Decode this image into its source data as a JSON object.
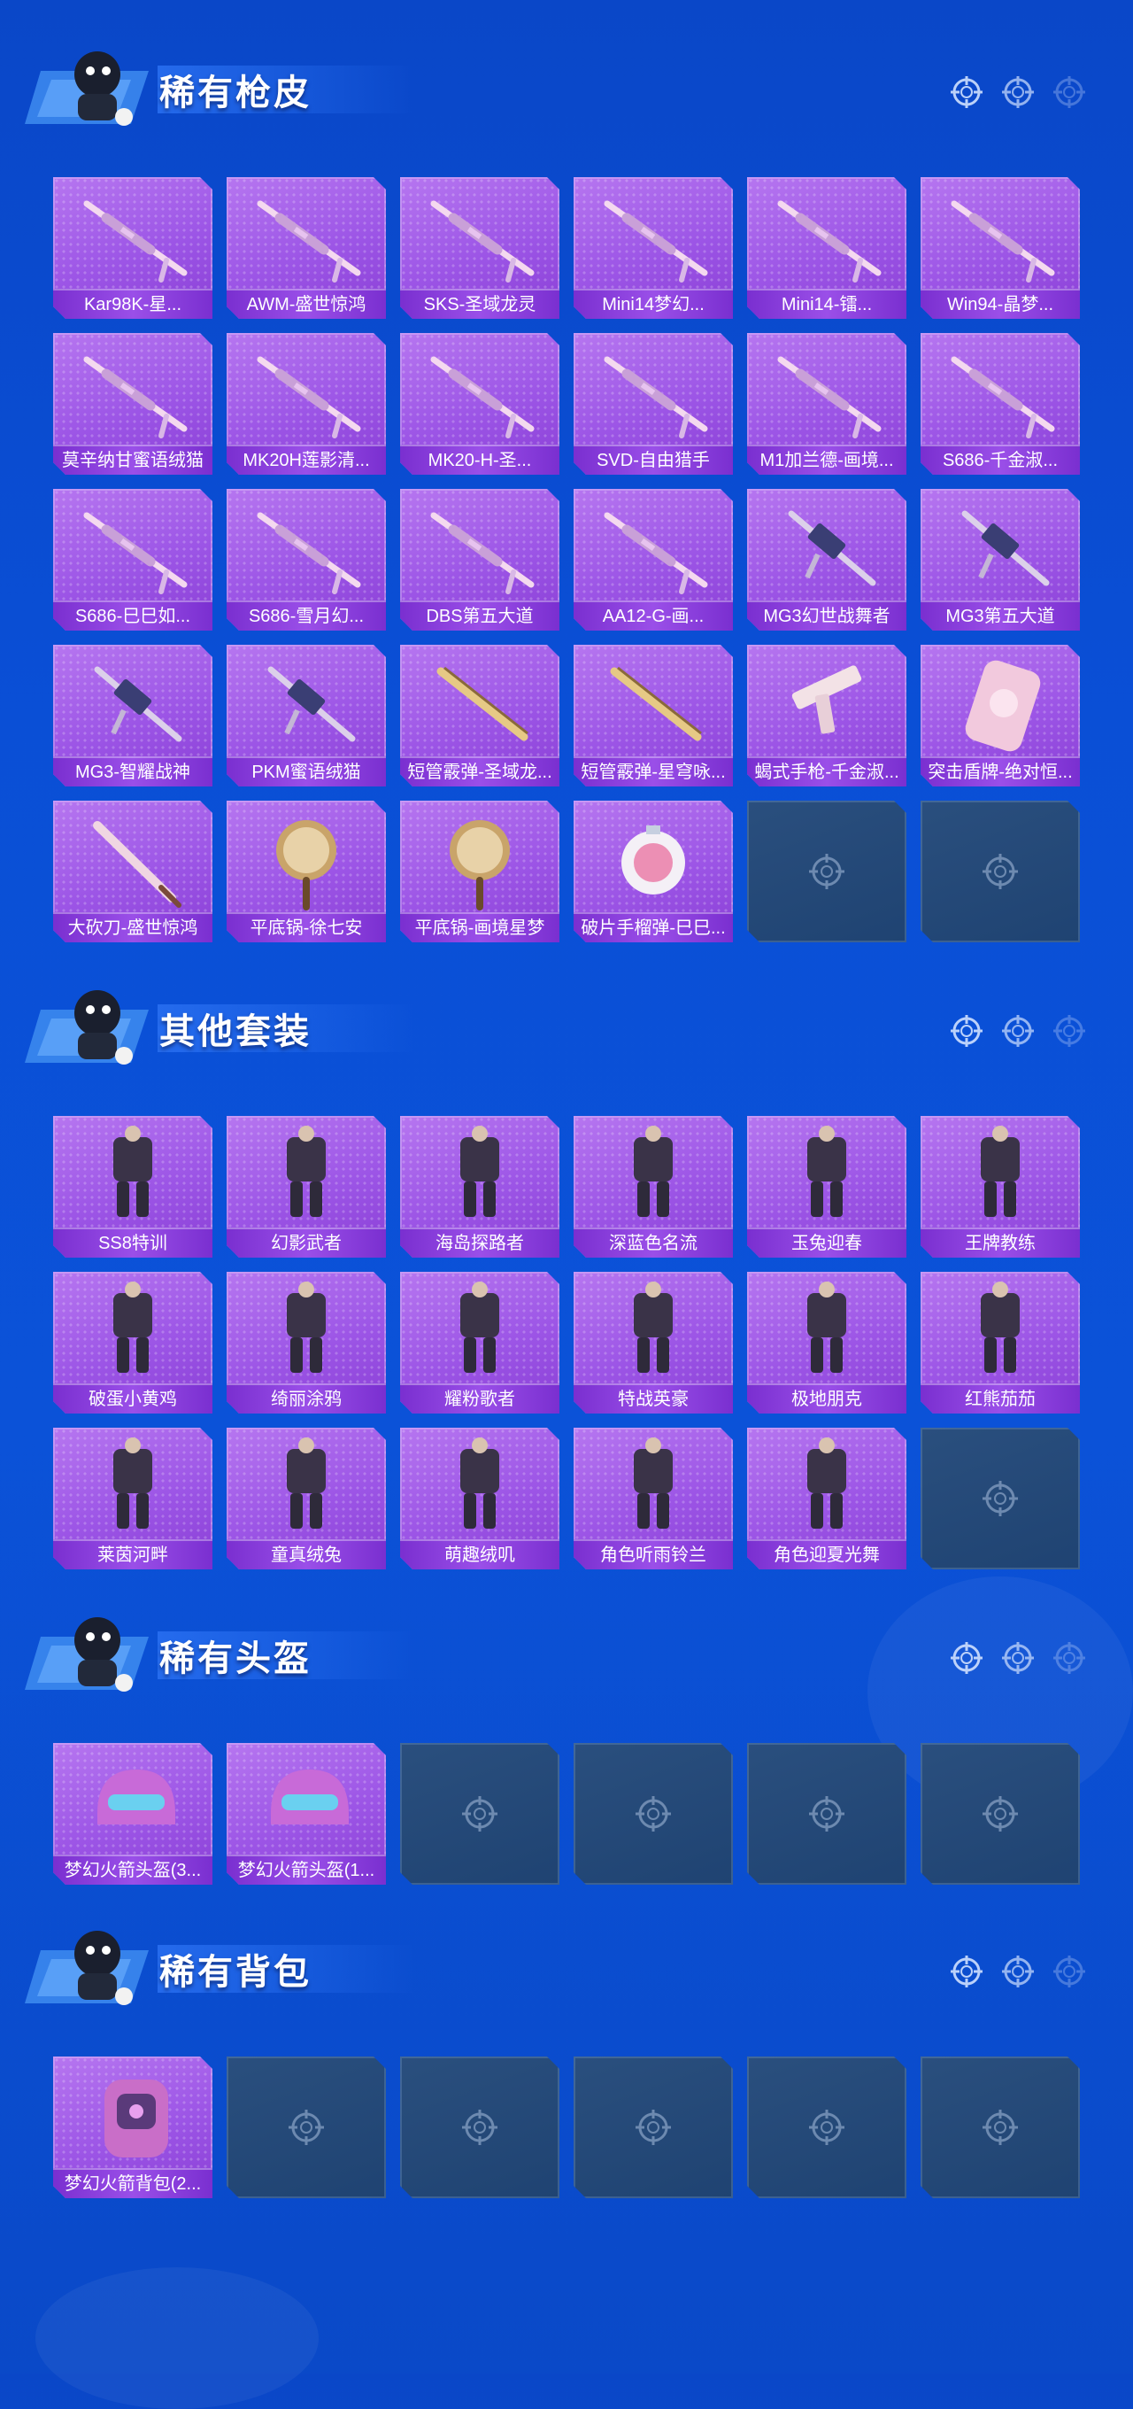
{
  "sections": [
    {
      "title": "稀有枪皮",
      "items": [
        {
          "label": "Kar98K-星...",
          "icon": "rifle"
        },
        {
          "label": "AWM-盛世惊鸿",
          "icon": "rifle"
        },
        {
          "label": "SKS-圣域龙灵",
          "icon": "rifle"
        },
        {
          "label": "Mini14梦幻...",
          "icon": "rifle"
        },
        {
          "label": "Mini14-镭...",
          "icon": "rifle"
        },
        {
          "label": "Win94-晶梦...",
          "icon": "rifle"
        },
        {
          "label": "莫辛纳甘蜜语绒猫",
          "icon": "rifle"
        },
        {
          "label": "MK20H莲影清...",
          "icon": "rifle"
        },
        {
          "label": "MK20-H-圣...",
          "icon": "rifle"
        },
        {
          "label": "SVD-自由猎手",
          "icon": "rifle"
        },
        {
          "label": "M1加兰德-画境...",
          "icon": "rifle"
        },
        {
          "label": "S686-千金淑...",
          "icon": "rifle"
        },
        {
          "label": "S686-巳巳如...",
          "icon": "rifle"
        },
        {
          "label": "S686-雪月幻...",
          "icon": "rifle"
        },
        {
          "label": "DBS第五大道",
          "icon": "rifle"
        },
        {
          "label": "AA12-G-画...",
          "icon": "rifle"
        },
        {
          "label": "MG3幻世战舞者",
          "icon": "machinegun"
        },
        {
          "label": "MG3第五大道",
          "icon": "machinegun"
        },
        {
          "label": "MG3-智耀战神",
          "icon": "machinegun"
        },
        {
          "label": "PKM蜜语绒猫",
          "icon": "machinegun"
        },
        {
          "label": "短管霰弹-圣域龙...",
          "icon": "shotgun"
        },
        {
          "label": "短管霰弹-星穹咏...",
          "icon": "shotgun"
        },
        {
          "label": "蝎式手枪-千金淑...",
          "icon": "pistol"
        },
        {
          "label": "突击盾牌-绝对恒...",
          "icon": "shield"
        },
        {
          "label": "大砍刀-盛世惊鸿",
          "icon": "machete"
        },
        {
          "label": "平底锅-徐七安",
          "icon": "pan"
        },
        {
          "label": "平底锅-画境星梦",
          "icon": "pan"
        },
        {
          "label": "破片手榴弹-巳巳...",
          "icon": "grenade"
        },
        {
          "label": "",
          "icon": "empty"
        },
        {
          "label": "",
          "icon": "empty"
        }
      ]
    },
    {
      "title": "其他套装",
      "items": [
        {
          "label": "SS8特训",
          "icon": "outfit"
        },
        {
          "label": "幻影武者",
          "icon": "outfit"
        },
        {
          "label": "海岛探路者",
          "icon": "outfit"
        },
        {
          "label": "深蓝色名流",
          "icon": "outfit"
        },
        {
          "label": "玉兔迎春",
          "icon": "outfit"
        },
        {
          "label": "王牌教练",
          "icon": "outfit"
        },
        {
          "label": "破蛋小黄鸡",
          "icon": "outfit"
        },
        {
          "label": "绮丽涂鸦",
          "icon": "outfit"
        },
        {
          "label": "耀粉歌者",
          "icon": "outfit"
        },
        {
          "label": "特战英豪",
          "icon": "outfit"
        },
        {
          "label": "极地朋克",
          "icon": "outfit"
        },
        {
          "label": "红熊茄茄",
          "icon": "outfit"
        },
        {
          "label": "莱茵河畔",
          "icon": "outfit"
        },
        {
          "label": "童真绒兔",
          "icon": "outfit"
        },
        {
          "label": "萌趣绒叽",
          "icon": "outfit"
        },
        {
          "label": "角色听雨铃兰",
          "icon": "outfit"
        },
        {
          "label": "角色迎夏光舞",
          "icon": "outfit"
        },
        {
          "label": "",
          "icon": "empty"
        }
      ]
    },
    {
      "title": "稀有头盔",
      "items": [
        {
          "label": "梦幻火箭头盔(3...",
          "icon": "helmet"
        },
        {
          "label": "梦幻火箭头盔(1...",
          "icon": "helmet"
        },
        {
          "label": "",
          "icon": "empty"
        },
        {
          "label": "",
          "icon": "empty"
        },
        {
          "label": "",
          "icon": "empty"
        },
        {
          "label": "",
          "icon": "empty"
        }
      ]
    },
    {
      "title": "稀有背包",
      "items": [
        {
          "label": "梦幻火箭背包(2...",
          "icon": "backpack"
        },
        {
          "label": "",
          "icon": "empty"
        },
        {
          "label": "",
          "icon": "empty"
        },
        {
          "label": "",
          "icon": "empty"
        },
        {
          "label": "",
          "icon": "empty"
        },
        {
          "label": "",
          "icon": "empty"
        }
      ]
    }
  ]
}
